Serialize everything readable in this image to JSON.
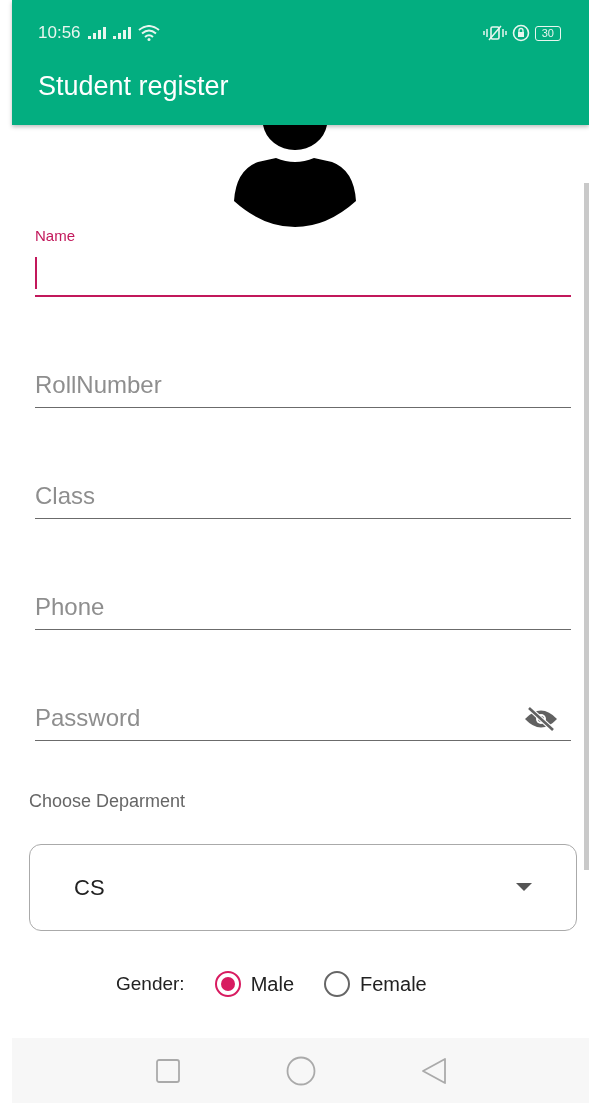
{
  "status_bar": {
    "time": "10:56",
    "battery": "30"
  },
  "app_bar": {
    "title": "Student register"
  },
  "fields": [
    {
      "label": "Name",
      "focused": true,
      "kind": "text"
    },
    {
      "label": "RollNumber",
      "focused": false,
      "kind": "text"
    },
    {
      "label": "Class",
      "focused": false,
      "kind": "text"
    },
    {
      "label": "Phone",
      "focused": false,
      "kind": "text"
    },
    {
      "label": "Password",
      "focused": false,
      "kind": "password"
    }
  ],
  "department": {
    "label": "Choose Deparment",
    "value": "CS"
  },
  "gender": {
    "label": "Gender:",
    "options": [
      {
        "label": "Male",
        "selected": true
      },
      {
        "label": "Female",
        "selected": false
      }
    ]
  }
}
